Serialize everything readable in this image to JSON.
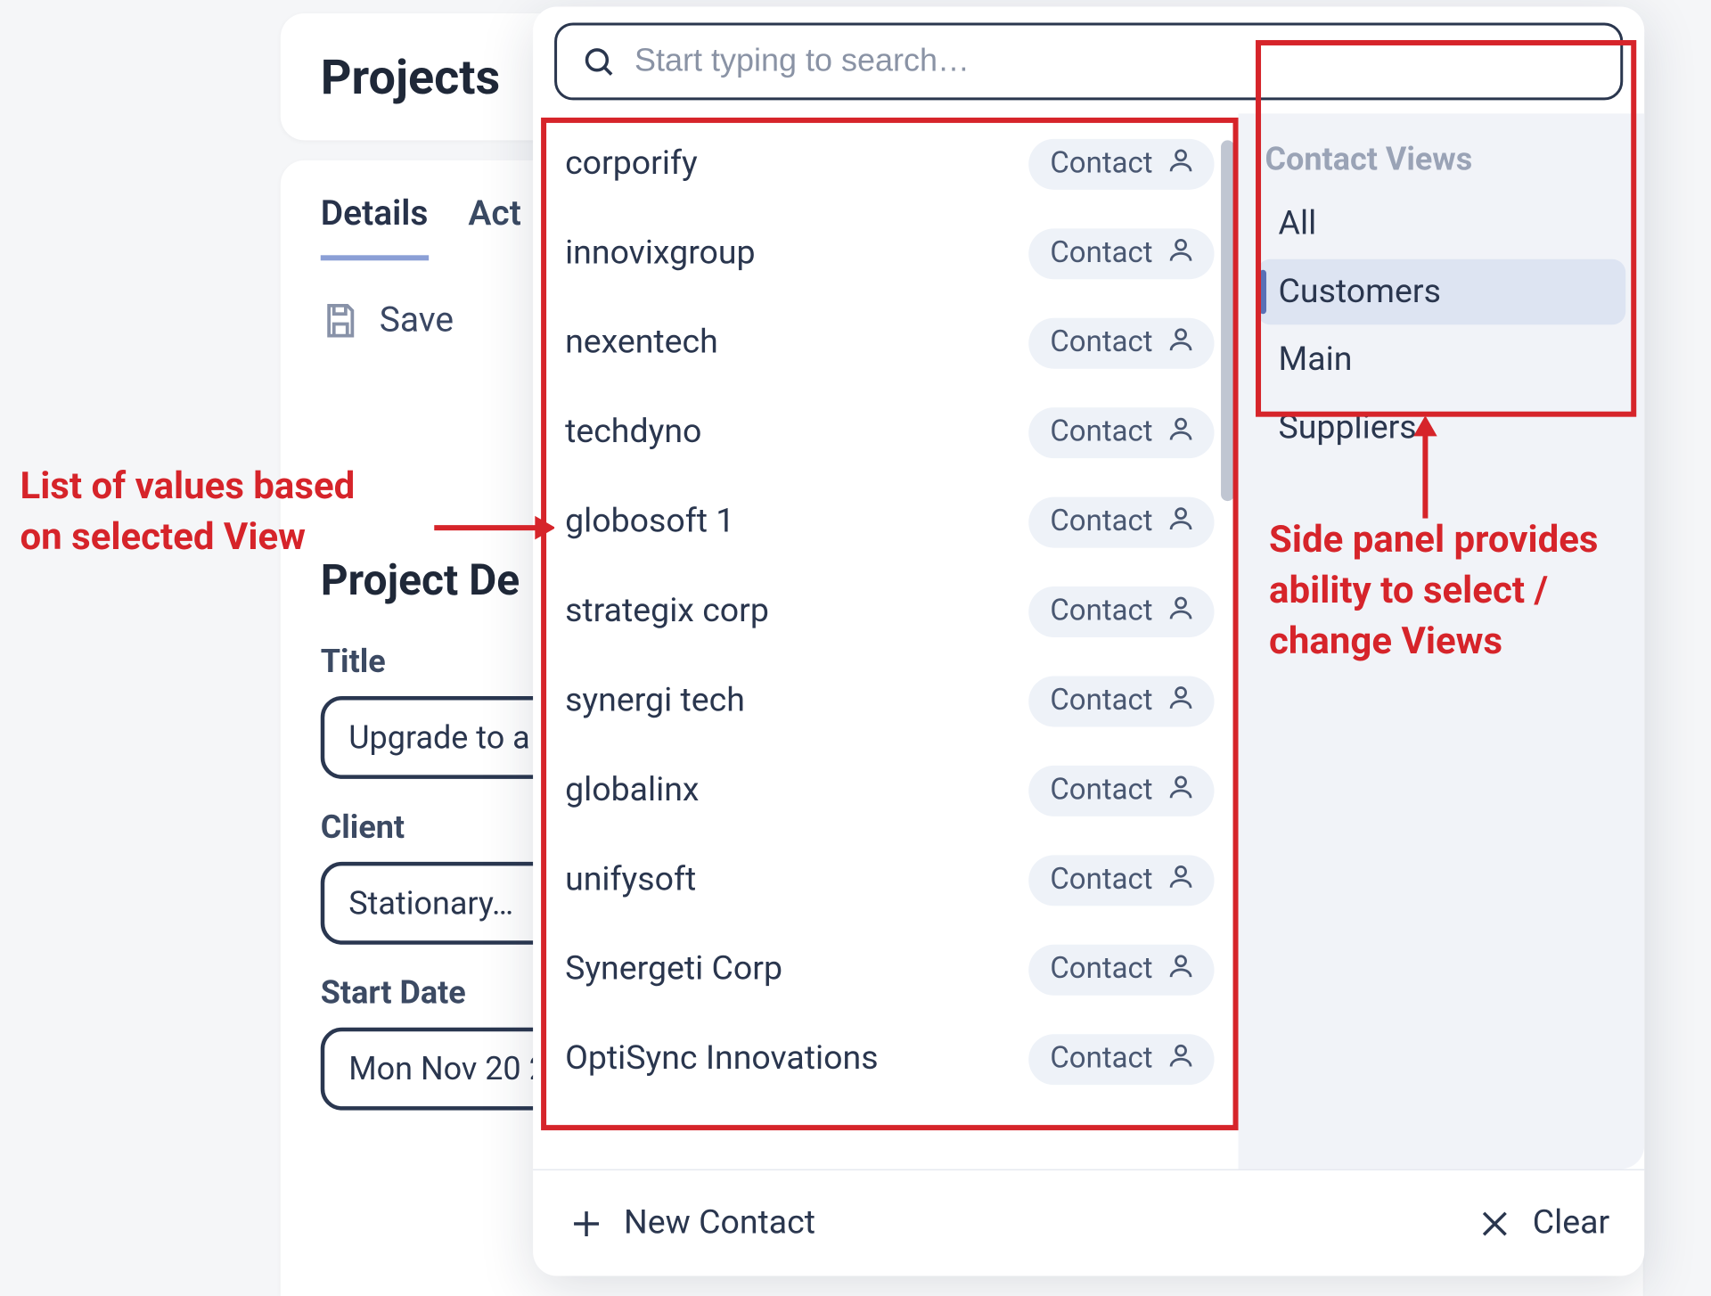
{
  "header": {
    "title": "Projects"
  },
  "tabs": {
    "details": "Details",
    "activity": "Act"
  },
  "toolbar": {
    "save_label": "Save"
  },
  "section": {
    "title": "Project De"
  },
  "fields": {
    "title_label": "Title",
    "title_value": "Upgrade to a",
    "client_label": "Client",
    "client_value": "Stationary…",
    "startdate_label": "Start Date",
    "startdate_value": "Mon Nov 20 2"
  },
  "picker": {
    "search_placeholder": "Start typing to search…",
    "badge_label": "Contact",
    "results": [
      "corporify",
      "innovixgroup",
      "nexentech",
      "techdyno",
      "globosoft 1",
      "strategix corp",
      "synergi tech",
      "globalinx",
      "unifysoft",
      "Synergeti Corp",
      "OptiSync Innovations"
    ],
    "new_label": "New Contact",
    "clear_label": "Clear"
  },
  "views": {
    "title": "Contact Views",
    "items": [
      "All",
      "Customers",
      "Main",
      "Suppliers"
    ],
    "selected_index": 1
  },
  "annotations": {
    "left": "List of values based\non selected View",
    "right": "Side panel provides\nability to select /\nchange Views"
  }
}
